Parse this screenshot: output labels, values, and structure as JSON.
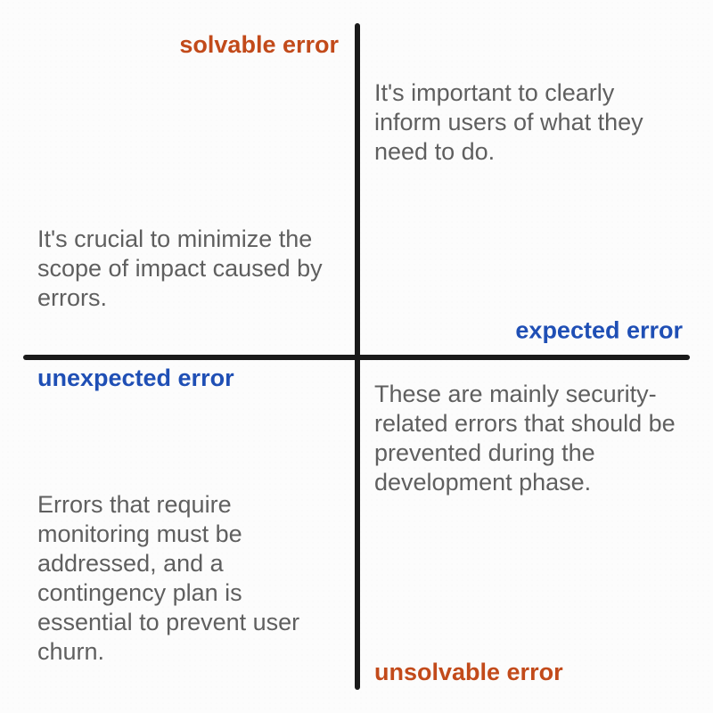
{
  "axis": {
    "top": "solvable error",
    "bottom": "unsolvable error",
    "left": "unexpected error",
    "right": "expected error"
  },
  "quadrants": {
    "top_left": "It's crucial to minimize the scope of impact caused by errors.",
    "top_right": "It's important to clearly inform users of what they need to do.",
    "bottom_left": "Errors that require monitoring must be addressed, and a contingency plan is essential to prevent user churn.",
    "bottom_right": "These are mainly security-related errors that should be prevented during the development phase."
  },
  "colors": {
    "axis_orange": "#c24a1a",
    "axis_blue": "#1f4fb5",
    "body_text": "#5f5f5f",
    "axis_line": "#1a1a1a"
  }
}
